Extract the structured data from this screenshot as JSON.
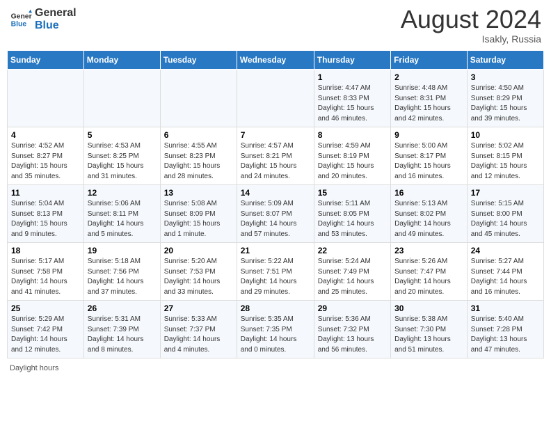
{
  "header": {
    "logo_line1": "General",
    "logo_line2": "Blue",
    "month_year": "August 2024",
    "location": "Isakly, Russia"
  },
  "days_of_week": [
    "Sunday",
    "Monday",
    "Tuesday",
    "Wednesday",
    "Thursday",
    "Friday",
    "Saturday"
  ],
  "weeks": [
    [
      {
        "num": "",
        "detail": ""
      },
      {
        "num": "",
        "detail": ""
      },
      {
        "num": "",
        "detail": ""
      },
      {
        "num": "",
        "detail": ""
      },
      {
        "num": "1",
        "detail": "Sunrise: 4:47 AM\nSunset: 8:33 PM\nDaylight: 15 hours and 46 minutes."
      },
      {
        "num": "2",
        "detail": "Sunrise: 4:48 AM\nSunset: 8:31 PM\nDaylight: 15 hours and 42 minutes."
      },
      {
        "num": "3",
        "detail": "Sunrise: 4:50 AM\nSunset: 8:29 PM\nDaylight: 15 hours and 39 minutes."
      }
    ],
    [
      {
        "num": "4",
        "detail": "Sunrise: 4:52 AM\nSunset: 8:27 PM\nDaylight: 15 hours and 35 minutes."
      },
      {
        "num": "5",
        "detail": "Sunrise: 4:53 AM\nSunset: 8:25 PM\nDaylight: 15 hours and 31 minutes."
      },
      {
        "num": "6",
        "detail": "Sunrise: 4:55 AM\nSunset: 8:23 PM\nDaylight: 15 hours and 28 minutes."
      },
      {
        "num": "7",
        "detail": "Sunrise: 4:57 AM\nSunset: 8:21 PM\nDaylight: 15 hours and 24 minutes."
      },
      {
        "num": "8",
        "detail": "Sunrise: 4:59 AM\nSunset: 8:19 PM\nDaylight: 15 hours and 20 minutes."
      },
      {
        "num": "9",
        "detail": "Sunrise: 5:00 AM\nSunset: 8:17 PM\nDaylight: 15 hours and 16 minutes."
      },
      {
        "num": "10",
        "detail": "Sunrise: 5:02 AM\nSunset: 8:15 PM\nDaylight: 15 hours and 12 minutes."
      }
    ],
    [
      {
        "num": "11",
        "detail": "Sunrise: 5:04 AM\nSunset: 8:13 PM\nDaylight: 15 hours and 9 minutes."
      },
      {
        "num": "12",
        "detail": "Sunrise: 5:06 AM\nSunset: 8:11 PM\nDaylight: 14 hours and 5 minutes."
      },
      {
        "num": "13",
        "detail": "Sunrise: 5:08 AM\nSunset: 8:09 PM\nDaylight: 15 hours and 1 minute."
      },
      {
        "num": "14",
        "detail": "Sunrise: 5:09 AM\nSunset: 8:07 PM\nDaylight: 14 hours and 57 minutes."
      },
      {
        "num": "15",
        "detail": "Sunrise: 5:11 AM\nSunset: 8:05 PM\nDaylight: 14 hours and 53 minutes."
      },
      {
        "num": "16",
        "detail": "Sunrise: 5:13 AM\nSunset: 8:02 PM\nDaylight: 14 hours and 49 minutes."
      },
      {
        "num": "17",
        "detail": "Sunrise: 5:15 AM\nSunset: 8:00 PM\nDaylight: 14 hours and 45 minutes."
      }
    ],
    [
      {
        "num": "18",
        "detail": "Sunrise: 5:17 AM\nSunset: 7:58 PM\nDaylight: 14 hours and 41 minutes."
      },
      {
        "num": "19",
        "detail": "Sunrise: 5:18 AM\nSunset: 7:56 PM\nDaylight: 14 hours and 37 minutes."
      },
      {
        "num": "20",
        "detail": "Sunrise: 5:20 AM\nSunset: 7:53 PM\nDaylight: 14 hours and 33 minutes."
      },
      {
        "num": "21",
        "detail": "Sunrise: 5:22 AM\nSunset: 7:51 PM\nDaylight: 14 hours and 29 minutes."
      },
      {
        "num": "22",
        "detail": "Sunrise: 5:24 AM\nSunset: 7:49 PM\nDaylight: 14 hours and 25 minutes."
      },
      {
        "num": "23",
        "detail": "Sunrise: 5:26 AM\nSunset: 7:47 PM\nDaylight: 14 hours and 20 minutes."
      },
      {
        "num": "24",
        "detail": "Sunrise: 5:27 AM\nSunset: 7:44 PM\nDaylight: 14 hours and 16 minutes."
      }
    ],
    [
      {
        "num": "25",
        "detail": "Sunrise: 5:29 AM\nSunset: 7:42 PM\nDaylight: 14 hours and 12 minutes."
      },
      {
        "num": "26",
        "detail": "Sunrise: 5:31 AM\nSunset: 7:39 PM\nDaylight: 14 hours and 8 minutes."
      },
      {
        "num": "27",
        "detail": "Sunrise: 5:33 AM\nSunset: 7:37 PM\nDaylight: 14 hours and 4 minutes."
      },
      {
        "num": "28",
        "detail": "Sunrise: 5:35 AM\nSunset: 7:35 PM\nDaylight: 14 hours and 0 minutes."
      },
      {
        "num": "29",
        "detail": "Sunrise: 5:36 AM\nSunset: 7:32 PM\nDaylight: 13 hours and 56 minutes."
      },
      {
        "num": "30",
        "detail": "Sunrise: 5:38 AM\nSunset: 7:30 PM\nDaylight: 13 hours and 51 minutes."
      },
      {
        "num": "31",
        "detail": "Sunrise: 5:40 AM\nSunset: 7:28 PM\nDaylight: 13 hours and 47 minutes."
      }
    ]
  ],
  "footer": {
    "label": "Daylight hours"
  }
}
